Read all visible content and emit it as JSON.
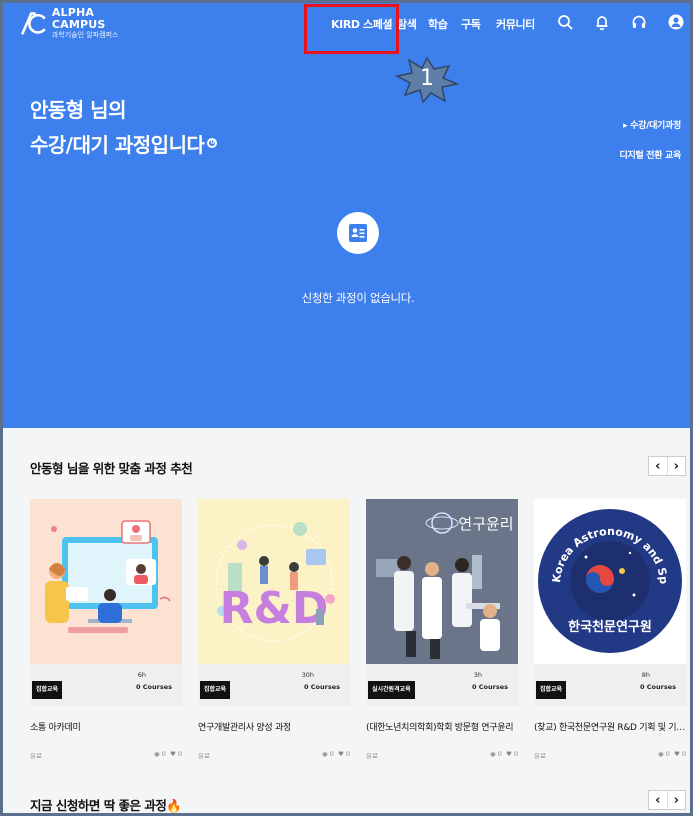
{
  "brand": {
    "title": "ALPHA CAMPUS",
    "subtitle": "과학기술인 알파캠퍼스"
  },
  "nav": {
    "items": [
      {
        "label": "KIRD 스페셜"
      },
      {
        "label": "탐색"
      },
      {
        "label": "학습"
      },
      {
        "label": "구독"
      },
      {
        "label": "커뮤니티"
      }
    ],
    "icons": [
      "search-icon",
      "bell-icon",
      "headset-icon",
      "user-icon"
    ]
  },
  "annotation": {
    "step_number": "1",
    "highlight_color": "#e8121a"
  },
  "hero": {
    "title_line1": "안동형 님의",
    "title_line2": "수강/대기 과정입니다",
    "count": "0",
    "links": [
      "▸ 수강/대기과정",
      "디지털 전환 교육"
    ],
    "empty_message": "신청한 과정이 없습니다.",
    "background": "#3d7fed"
  },
  "recommend": {
    "title": "안동형 님을 위한 맞춤 과정 추천",
    "prev": "‹",
    "next": "›",
    "cards": [
      {
        "badge": "집합교육",
        "hours": "6h",
        "courses": "0 Courses",
        "title": "소통 아카데미",
        "price": "유료",
        "views": "◉ 0",
        "likes": "♥ 0"
      },
      {
        "badge": "집합교육",
        "hours": "30h",
        "courses": "0 Courses",
        "title": "연구개발관리사 양성 과정",
        "price": "유료",
        "views": "◉ 0",
        "likes": "♥ 0"
      },
      {
        "badge": "실시간원격교육",
        "hours": "3h",
        "courses": "0 Courses",
        "title": "(대한노년치의학회)학회 방문형 연구윤리",
        "price": "유료",
        "views": "◉ 0",
        "likes": "♥ 0"
      },
      {
        "badge": "집합교육",
        "hours": "8h",
        "courses": "0 Courses",
        "title": "(찾교) 한국천문연구원 R&D 기획 및 기술…",
        "price": "유료",
        "views": "◉ 0",
        "likes": "♥ 0"
      }
    ],
    "thumb_text": {
      "rnd": "R&D",
      "ethics": "연구윤리",
      "kasi_ring": "Korea Astronomy and Space Science Institute",
      "kasi_name": "한국천문연구원"
    }
  },
  "recommend2": {
    "title": "지금 신청하면 딱 좋은 과정",
    "emoji": "🔥",
    "prev": "‹",
    "next": "›"
  }
}
